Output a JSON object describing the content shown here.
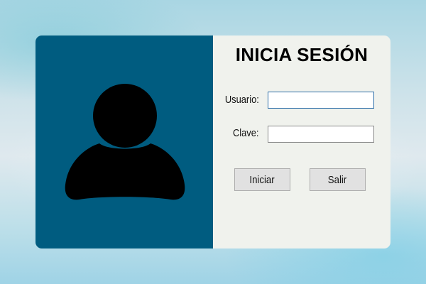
{
  "form": {
    "title": "INICIA SESIÓN",
    "user_label": "Usuario:",
    "user_value": "",
    "password_label": "Clave:",
    "password_value": ""
  },
  "buttons": {
    "login_label": "Iniciar",
    "exit_label": "Salir"
  },
  "icons": {
    "avatar": "user-silhouette-icon"
  },
  "colors": {
    "left_panel": "#005c80",
    "right_panel": "#f0f2ed",
    "button_bg": "#e1e1e1",
    "focus_border": "#2f6fa8"
  }
}
